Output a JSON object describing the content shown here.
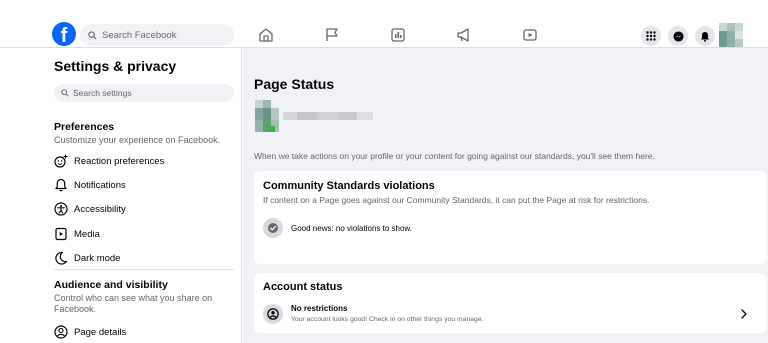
{
  "header": {
    "logo": "f",
    "search_placeholder": "Search Facebook",
    "nav_icons": [
      "home-icon",
      "flag-icon",
      "news-icon",
      "megaphone-icon",
      "video-icon"
    ],
    "right_icons": [
      "menu-grid-icon",
      "messenger-icon",
      "bell-icon"
    ]
  },
  "sidebar": {
    "title": "Settings & privacy",
    "search_placeholder": "Search settings",
    "preferences": {
      "title": "Preferences",
      "subtitle": "Customize your experience on Facebook.",
      "items": [
        {
          "label": "Reaction preferences",
          "icon": "reaction-icon"
        },
        {
          "label": "Notifications",
          "icon": "bell-icon"
        },
        {
          "label": "Accessibility",
          "icon": "accessibility-icon"
        },
        {
          "label": "Media",
          "icon": "media-icon"
        },
        {
          "label": "Dark mode",
          "icon": "moon-icon"
        }
      ]
    },
    "audience": {
      "title": "Audience and visibility",
      "subtitle": "Control who can see what you share on Facebook.",
      "items": [
        {
          "label": "Page details",
          "icon": "user-circle-icon"
        }
      ]
    }
  },
  "main": {
    "title": "Page Status",
    "notice": "When we take actions on your profile or your content for going against our standards, you'll see them here.",
    "community": {
      "title": "Community Standards violations",
      "subtitle": "If content on a Page goes against our Community Standards, it can put the Page at risk for restrictions.",
      "status": "Good news: no violations to show."
    },
    "account": {
      "title": "Account status",
      "status_title": "No restrictions",
      "status_sub": "Your account looks good! Check in on other things you manage."
    }
  },
  "colors": {
    "brand": "#0866ff",
    "background": "#f0f2f5",
    "secondary_text": "#65676b"
  }
}
